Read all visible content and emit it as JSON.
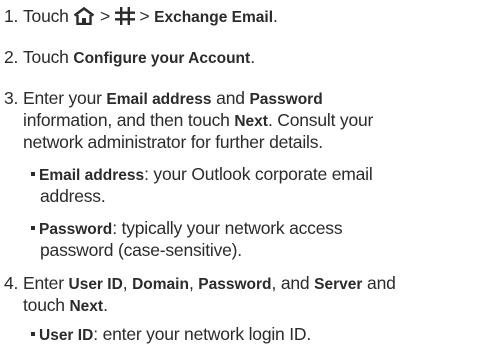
{
  "steps": [
    {
      "number": "1.",
      "text_touch": "Touch",
      "sep1": ">",
      "sep2": ">",
      "bold": "Exchange Email",
      "end": ".",
      "icons": [
        "home-icon",
        "apps-grid-icon"
      ]
    },
    {
      "number": "2.",
      "pre": "Touch ",
      "bold": "Configure your Account",
      "end": "."
    },
    {
      "number": "3.",
      "l1_pre": "Enter your ",
      "l1_b1": "Email address",
      "l1_mid": " and ",
      "l1_b2": "Password",
      "l2_pre": "information, and then touch ",
      "l2_b": "Next",
      "l2_post": ". Consult your",
      "l3": "network administrator for further details.",
      "sub": [
        {
          "bold": "Email address",
          "l1_post": ": your Outlook corporate email",
          "l2": "address."
        },
        {
          "bold": "Password",
          "l1_post": ": typically your network access",
          "l2": "password (case-sensitive)."
        }
      ]
    },
    {
      "number": "4.",
      "l1_pre": "Enter ",
      "b1": "User ID",
      "c1": ", ",
      "b2": "Domain",
      "c2": ", ",
      "b3": "Password",
      "c3": ", and ",
      "b4": "Server",
      "c4": " and",
      "l2_pre": "touch ",
      "l2_b": "Next",
      "l2_post": ".",
      "sub": [
        {
          "bold": "User ID",
          "post": ": enter your network login ID."
        }
      ]
    }
  ]
}
